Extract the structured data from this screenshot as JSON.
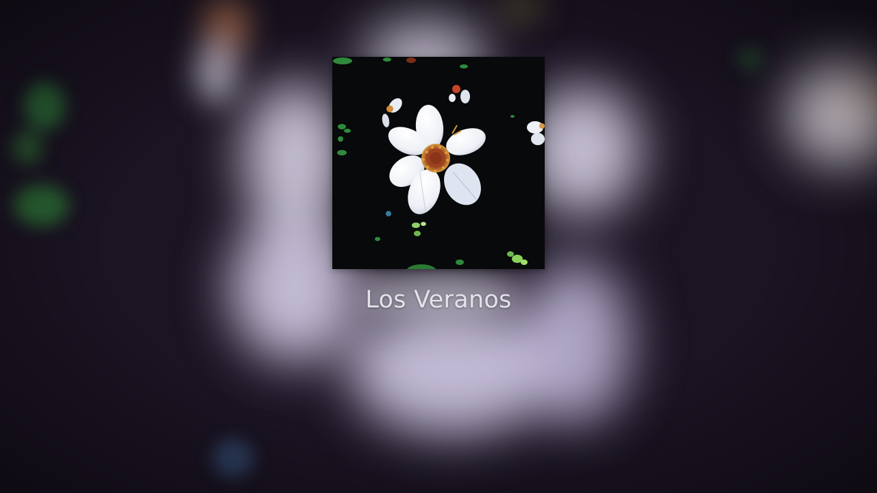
{
  "track": {
    "title": "Los Veranos"
  },
  "artwork": {
    "icon": "white-flower-photo",
    "background": "blurred-flower-photo"
  },
  "colors": {
    "background": "#1b1423",
    "title_text": "#e4e1e9",
    "cover_background": "#07090a"
  }
}
